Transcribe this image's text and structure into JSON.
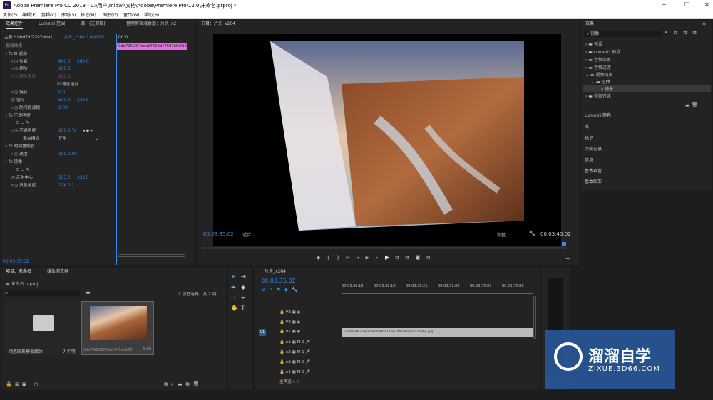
{
  "title": {
    "app": "Adobe Premiere Pro CC 2018 - C:\\用户\\midwi\\文档\\Adobe\\Premiere Pro\\12.0\\未命名.prproj *",
    "logo": "Pr"
  },
  "menu": [
    "文件(F)",
    "编辑(E)",
    "剪辑(C)",
    "序列(S)",
    "标记(M)",
    "图形(G)",
    "窗口(W)",
    "帮助(H)"
  ],
  "tabs_left": {
    "effect_controls": "效果控件",
    "lumetri": "Lumetri 范围",
    "source": "源：(无剪辑)",
    "audio_mixer": "音频剪辑混合器：片头_x2"
  },
  "effect_controls": {
    "master": "主要 * 0dd79f2397dda1...",
    "seq": "片头_x264 * 0dd79f...",
    "time0": "00:0",
    "clip": "0dd79f2397dda1449dd17697bfb7d0a20",
    "video_effects": "视频效果",
    "motion": "运动",
    "position": {
      "label": "位置",
      "v1": "640.0",
      "v2": "360.0"
    },
    "scale": {
      "label": "缩放",
      "v": "100.0"
    },
    "scale_width": {
      "label": "缩放宽度",
      "v": "100.0"
    },
    "uniform": "等比缩放",
    "rotation": {
      "label": "旋转",
      "v": "0.0"
    },
    "anchor": {
      "label": "锚点",
      "v1": "500.0",
      "v2": "333.5"
    },
    "antiflicker": {
      "label": "防闪烁滤镜",
      "v": "0.00"
    },
    "opacity": "不透明度",
    "opacity_val": {
      "label": "不透明度",
      "v": "100.0 %"
    },
    "blend": {
      "label": "混合模式",
      "v": "正常"
    },
    "time_remap": "时间重映射",
    "speed": {
      "label": "速度",
      "v": "100.00%"
    },
    "mirror": "镜像",
    "reflect_center": {
      "label": "反射中心",
      "v1": "563.0",
      "v2": "333.5"
    },
    "reflect_angle": {
      "label": "反射角度",
      "v": "124.0 °"
    },
    "timecode": "00:03:35:02"
  },
  "program": {
    "tab": "节目：片头_x264",
    "timecode": "00:03:35:02",
    "fit": "适合",
    "quality": "完整",
    "duration": "00:03:40:02"
  },
  "effects": {
    "title": "效果",
    "search": "镜像",
    "items": [
      "预设",
      "Lumetri 预设",
      "音频效果",
      "音频过渡",
      "视频效果",
      "扭曲",
      "镜像",
      "视频过渡"
    ],
    "panels": [
      "Lumetri 颜色",
      "库",
      "标记",
      "历史记录",
      "信息",
      "基本声音",
      "基本图形"
    ]
  },
  "project": {
    "tab": "项目：未命名",
    "tab2": "媒体浏览器",
    "file": "未命名.prproj",
    "selection": "1 项已选择，共 2 项",
    "folder_name": "动态图形模板媒体",
    "folder_count": "7 个项",
    "clip_name": "0dd79f2397dda1449dd17697bfb7d0a20",
    "clip_dur": "5:00"
  },
  "timeline": {
    "tab": "片头_x264",
    "timecode": "00:03:35:02",
    "ticks": [
      "00:03:36:15",
      "00:03:36:18",
      "00:03:36:21",
      "00:03:37:00",
      "00:03:37:03",
      "00:03:37:06"
    ],
    "tracks": [
      "V3",
      "V2",
      "V1",
      "A1",
      "A2",
      "A3",
      "A4"
    ],
    "master": "主声道",
    "master_val": "0.0",
    "clip": "0dd79f2397dda1449dd17697bfb7d0a20d7ee6e.jpg"
  },
  "watermark": {
    "cn": "溜溜自学",
    "url": "ZIXUE.3D66.COM"
  },
  "colors": {
    "accent": "#2d8ceb",
    "clip_pink": "#e66fe6",
    "clip_gray": "#b9b9b9",
    "bg": "#1d1d1d",
    "panel": "#232323"
  }
}
